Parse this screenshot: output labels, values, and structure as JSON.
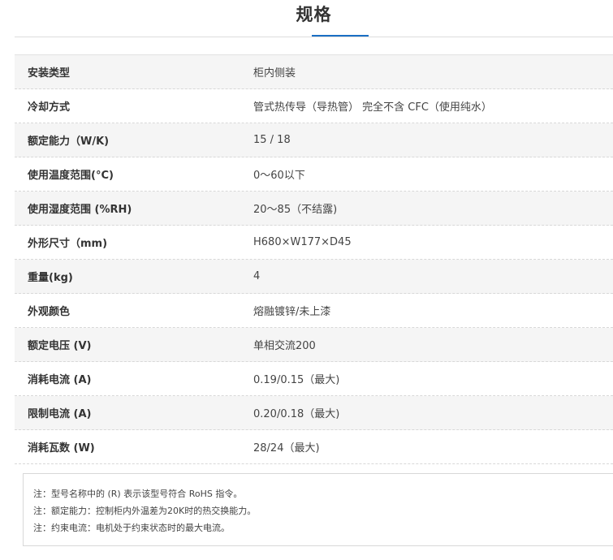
{
  "header": {
    "title": "规格"
  },
  "specs": [
    {
      "label": "安装类型",
      "value": "柜内侧装"
    },
    {
      "label": "冷却方式",
      "value": "管式热传导（导热管） 完全不含 CFC（使用纯水）"
    },
    {
      "label": "额定能力（W/K)",
      "value": "15 / 18"
    },
    {
      "label": "使用温度范围(°C)",
      "value": "0～60以下"
    },
    {
      "label": "使用湿度范围 (%RH)",
      "value": "20～85（不结露)"
    },
    {
      "label": "外形尺寸（mm)",
      "value": "H680×W177×D45"
    },
    {
      "label": "重量(kg)",
      "value": "4"
    },
    {
      "label": "外观颜色",
      "value": "熔融镀锌/未上漆"
    },
    {
      "label": "额定电压 (V)",
      "value": "单相交流200"
    },
    {
      "label": "消耗电流 (A)",
      "value": "0.19/0.15（最大)"
    },
    {
      "label": "限制电流 (A)",
      "value": "0.20/0.18（最大)"
    },
    {
      "label": "消耗瓦数 (W)",
      "value": "28/24（最大)"
    }
  ],
  "notes": [
    "注：型号名称中的 (R) 表示该型号符合 RoHS 指令。",
    "注：额定能力：控制柜内外温差为20K时的热交换能力。",
    "注：约束电流：电机处于约束状态时的最大电流。"
  ]
}
